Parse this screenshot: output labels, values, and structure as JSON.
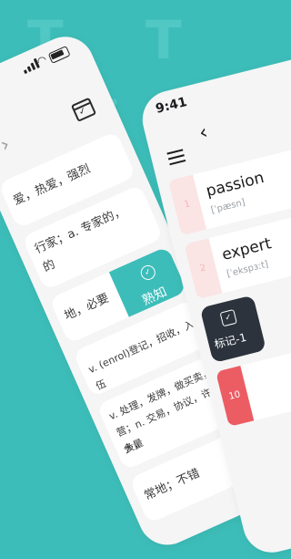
{
  "background": {
    "color": "#3dbdb9",
    "logo_glyph": "T"
  },
  "left_phone": {
    "chevron_icon": "chevron-right-icon",
    "calendar_icon": "calendar-check-icon",
    "definitions": [
      "爱，热爱，强烈",
      "行家；a. 专家的，",
      "的",
      "地，必要",
      "v. (enrol)登记，招收，入伍",
      "v. 处理，发牌，做买卖，经",
      "营；n. 交易，协议，许多，",
      "大量",
      "常地；不错"
    ],
    "known_label": "熟知"
  },
  "right_phone": {
    "time": "9:41",
    "words": [
      {
        "rank": "1",
        "word": "passion",
        "phonetic": "[ˈpæsn]"
      },
      {
        "rank": "2",
        "word": "expert",
        "phonetic": "[ˈekspɜːt]"
      }
    ],
    "mark_label": "标记-1",
    "rank_10": "10"
  },
  "colors": {
    "accent": "#3dbdb9",
    "rank_hot": "#ec5c63",
    "dark_card": "#2c333d"
  }
}
